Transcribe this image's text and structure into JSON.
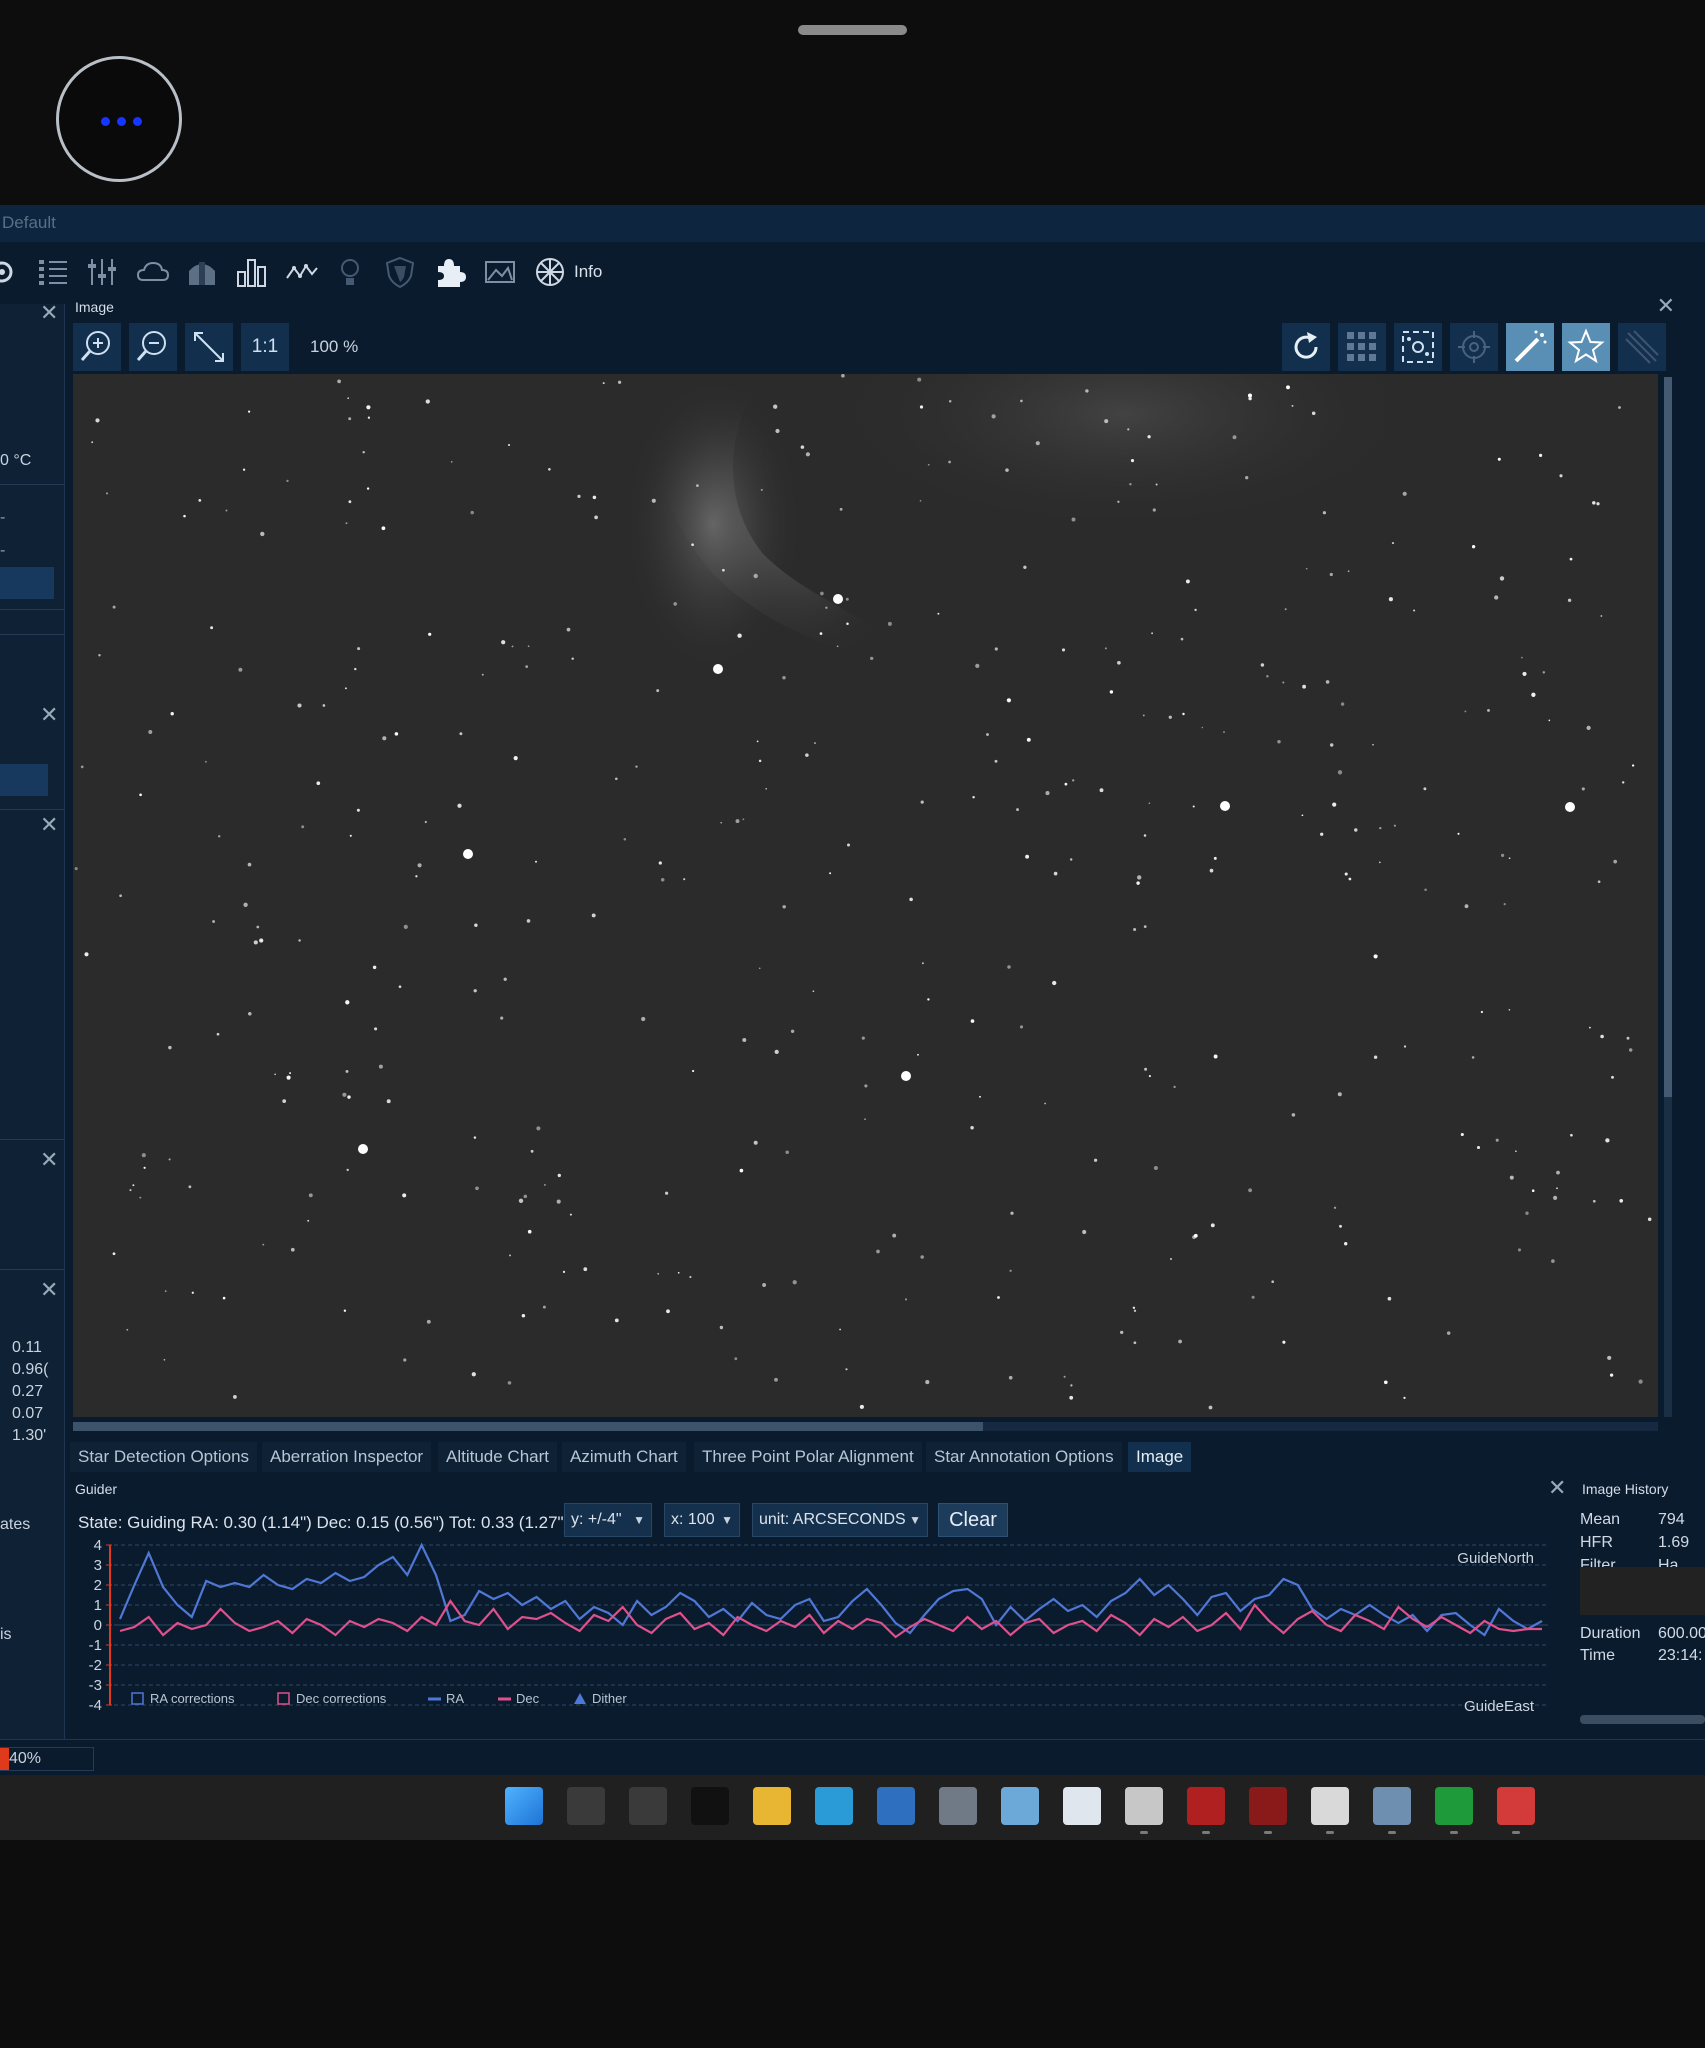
{
  "window": {
    "profile_title": "Default"
  },
  "toolbar": {
    "icons": [
      "equipment-icon",
      "sequence-icon",
      "options-icon",
      "weather-icon",
      "dome-icon",
      "imaging-icon",
      "guiding-icon",
      "lightbulb-icon",
      "shield-icon",
      "plugins-icon",
      "framing-icon",
      "skyatlas-icon"
    ],
    "info_label": "Info"
  },
  "left_panel": {
    "temp": "0 °C",
    "values": [
      "0.11",
      "0.96(",
      "0.27",
      "0.07",
      "1.30'"
    ],
    "text_ates": "ates",
    "text_is": "is"
  },
  "image_panel": {
    "title": "Image",
    "zoom_one_to_one": "1:1",
    "zoom_level": "100 %"
  },
  "tabs": [
    "Star Detection Options",
    "Aberration Inspector",
    "Altitude Chart",
    "Azimuth Chart",
    "Three Point Polar Alignment",
    "Star Annotation Options",
    "Image"
  ],
  "active_tab": "Image",
  "guider": {
    "title": "Guider",
    "state_text": "State: Guiding  RA: 0.30 (1.14\")  Dec: 0.15 (0.56\")  Tot: 0.33 (1.27\")",
    "y_scale": "y: +/-4\"",
    "x_scale": "x: 100",
    "unit": "unit: ARCSECONDS",
    "clear_label": "Clear",
    "north_label": "GuideNorth",
    "east_label": "GuideEast",
    "legend": [
      "RA corrections",
      "Dec corrections",
      "RA",
      "Dec",
      "Dither"
    ],
    "colors": {
      "ra": "#4f78d6",
      "dec": "#e0508c",
      "grid": "#2c4766"
    }
  },
  "chart_data": {
    "type": "line",
    "title": "",
    "xlabel": "",
    "ylabel": "",
    "ylim": [
      -4,
      4
    ],
    "yticks": [
      4,
      3,
      2,
      1,
      0,
      -1,
      -2,
      -3,
      -4
    ],
    "x": [
      0,
      1,
      2,
      3,
      4,
      5,
      6,
      7,
      8,
      9,
      10,
      11,
      12,
      13,
      14,
      15,
      16,
      17,
      18,
      19,
      20,
      21,
      22,
      23,
      24,
      25,
      26,
      27,
      28,
      29,
      30,
      31,
      32,
      33,
      34,
      35,
      36,
      37,
      38,
      39,
      40,
      41,
      42,
      43,
      44,
      45,
      46,
      47,
      48,
      49,
      50,
      51,
      52,
      53,
      54,
      55,
      56,
      57,
      58,
      59,
      60,
      61,
      62,
      63,
      64,
      65,
      66,
      67,
      68,
      69,
      70,
      71,
      72,
      73,
      74,
      75,
      76,
      77,
      78,
      79,
      80,
      81,
      82,
      83,
      84,
      85,
      86,
      87,
      88,
      89,
      90,
      91,
      92,
      93,
      94,
      95,
      96,
      97,
      98,
      99
    ],
    "series": [
      {
        "name": "RA",
        "values": [
          0.3,
          2.0,
          3.6,
          1.9,
          1.0,
          0.4,
          2.2,
          1.9,
          2.1,
          1.9,
          2.5,
          2.0,
          1.8,
          2.3,
          2.1,
          2.6,
          2.2,
          2.4,
          3.0,
          3.4,
          2.5,
          4.0,
          2.5,
          0.2,
          0.5,
          1.7,
          1.3,
          1.6,
          1.0,
          1.4,
          0.8,
          1.2,
          0.3,
          0.9,
          0.6,
          0.0,
          1.2,
          0.5,
          0.9,
          1.6,
          1.2,
          0.4,
          0.8,
          0.2,
          1.1,
          0.5,
          0.3,
          1.0,
          1.3,
          0.2,
          0.4,
          1.2,
          1.8,
          1.0,
          0.1,
          -0.4,
          0.5,
          1.3,
          1.7,
          1.8,
          1.3,
          0.0,
          0.9,
          0.2,
          0.8,
          1.3,
          0.7,
          1.0,
          0.4,
          1.2,
          1.6,
          2.3,
          1.5,
          2.0,
          1.3,
          0.5,
          1.4,
          1.6,
          0.7,
          1.3,
          1.5,
          2.3,
          2.0,
          0.8,
          0.3,
          0.8,
          0.5,
          1.0,
          0.5,
          0.1,
          0.5,
          -0.3,
          0.5,
          0.6,
          0.0,
          -0.5,
          0.8,
          0.2,
          -0.2,
          0.2
        ]
      },
      {
        "name": "Dec",
        "values": [
          -0.3,
          -0.1,
          0.4,
          -0.5,
          0.1,
          -0.2,
          0.0,
          0.8,
          0.1,
          -0.3,
          -0.1,
          0.2,
          -0.4,
          0.3,
          0.0,
          -0.5,
          0.2,
          -0.1,
          0.3,
          0.1,
          -0.3,
          0.4,
          0.0,
          1.2,
          0.2,
          0.0,
          0.8,
          -0.2,
          0.4,
          0.3,
          0.6,
          0.1,
          -0.3,
          0.5,
          0.2,
          0.9,
          0.0,
          -0.4,
          0.3,
          0.6,
          -0.2,
          0.1,
          -0.5,
          0.4,
          0.0,
          -0.3,
          0.2,
          -0.1,
          0.5,
          -0.4,
          0.2,
          -0.2,
          0.3,
          0.1,
          -0.6,
          -0.1,
          0.3,
          0.0,
          -0.3,
          0.4,
          -0.2,
          0.2,
          -0.5,
          0.1,
          0.3,
          -0.4,
          0.0,
          0.2,
          -0.3,
          0.5,
          0.1,
          -0.5,
          0.3,
          -0.1,
          0.4,
          -0.3,
          0.0,
          0.6,
          -0.2,
          1.0,
          0.2,
          -0.4,
          0.3,
          0.7,
          0.0,
          -0.3,
          0.5,
          0.2,
          -0.2,
          0.9,
          0.3,
          -0.1,
          0.4,
          0.0,
          -0.4,
          0.2,
          -0.2,
          -0.3,
          -0.2,
          -0.2
        ]
      }
    ],
    "legend_position": "bottom-left"
  },
  "image_history": {
    "title": "Image History",
    "rows": [
      {
        "label": "Mean",
        "value": "794"
      },
      {
        "label": "HFR",
        "value": "1.69"
      },
      {
        "label": "Filter",
        "value": "Ha"
      },
      {
        "label": "Duration",
        "value": "600.00"
      },
      {
        "label": "Time",
        "value": "23:14:"
      }
    ]
  },
  "status": {
    "progress_text": "40%",
    "progress_value": 0.4
  },
  "taskbar": {
    "icons": [
      "windows-start-icon",
      "terminal-icon",
      "keyboard-icon",
      "usb-icon",
      "file-explorer-icon",
      "edge-icon",
      "calculator-icon",
      "settings-icon",
      "photos-icon",
      "search-tool-icon",
      "animal-app-icon",
      "astrometry-icon",
      "red-app-icon",
      "draw-app-icon",
      "nina-icon",
      "phd2-icon",
      "network-icon"
    ]
  }
}
